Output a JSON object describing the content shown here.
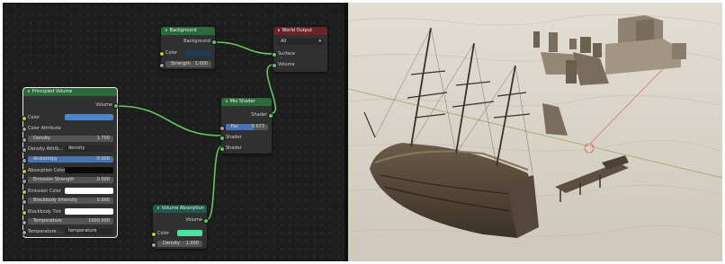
{
  "nodes": {
    "background": {
      "title": "Background",
      "out_background": "Background",
      "color_label": "Color",
      "strength_label": "Strength",
      "strength_value": "1.000"
    },
    "world_output": {
      "title": "World Output",
      "target": "All",
      "in_surface": "Surface",
      "in_volume": "Volume"
    },
    "principled_volume": {
      "title": "Principled Volume",
      "out_volume": "Volume",
      "color": "Color",
      "color_attribute": "Color Attribute",
      "density_label": "Density",
      "density_value": "1.700",
      "density_attribute_label": "Density Attrib...",
      "density_attribute_value": "density",
      "anisotropy_label": "Anisotropy",
      "anisotropy_value": "0.000",
      "absorption_color": "Absorption Color",
      "emission_strength_label": "Emission Strength",
      "emission_strength_value": "0.000",
      "emission_color": "Emission Color",
      "blackbody_intensity_label": "Blackbody Intensity",
      "blackbody_intensity_value": "0.000",
      "blackbody_tint": "Blackbody Tint",
      "temperature_label": "Temperature",
      "temperature_value": "1000.000",
      "temperature_attribute_label": "Temperature ...",
      "temperature_attribute_value": "temperature"
    },
    "mix_shader": {
      "title": "Mix Shader",
      "out_shader": "Shader",
      "fac_label": "Fac",
      "fac_value": "0.673",
      "in_shader_1": "Shader",
      "in_shader_2": "Shader"
    },
    "volume_absorption": {
      "title": "Volume Absorption",
      "out_volume": "Volume",
      "color_label": "Color",
      "density_label": "Density",
      "density_value": "1.000"
    }
  },
  "colors": {
    "editor_bg": "#1d1d1d",
    "node_body": "#303030",
    "shader_header": "#2b6a3a",
    "output_header": "#6b2228",
    "shader_link": "#63c763",
    "principled_color_swatch": "#4a86c9",
    "absorption_color_swatch": "#0a0a0a",
    "emission_color_swatch": "#ffffff",
    "blackbody_tint_swatch": "#ffffff",
    "volume_absorption_swatch": "#4fe0a2",
    "background_color_swatch": "#1e3a55",
    "sand": "#d2cbc0"
  },
  "viewport": {
    "scene": "galleon-on-sand-dunes-with-ruined-fortress",
    "objects": [
      "pirate-ship",
      "fortress-ruins",
      "wooden-pier",
      "light-empty"
    ]
  }
}
